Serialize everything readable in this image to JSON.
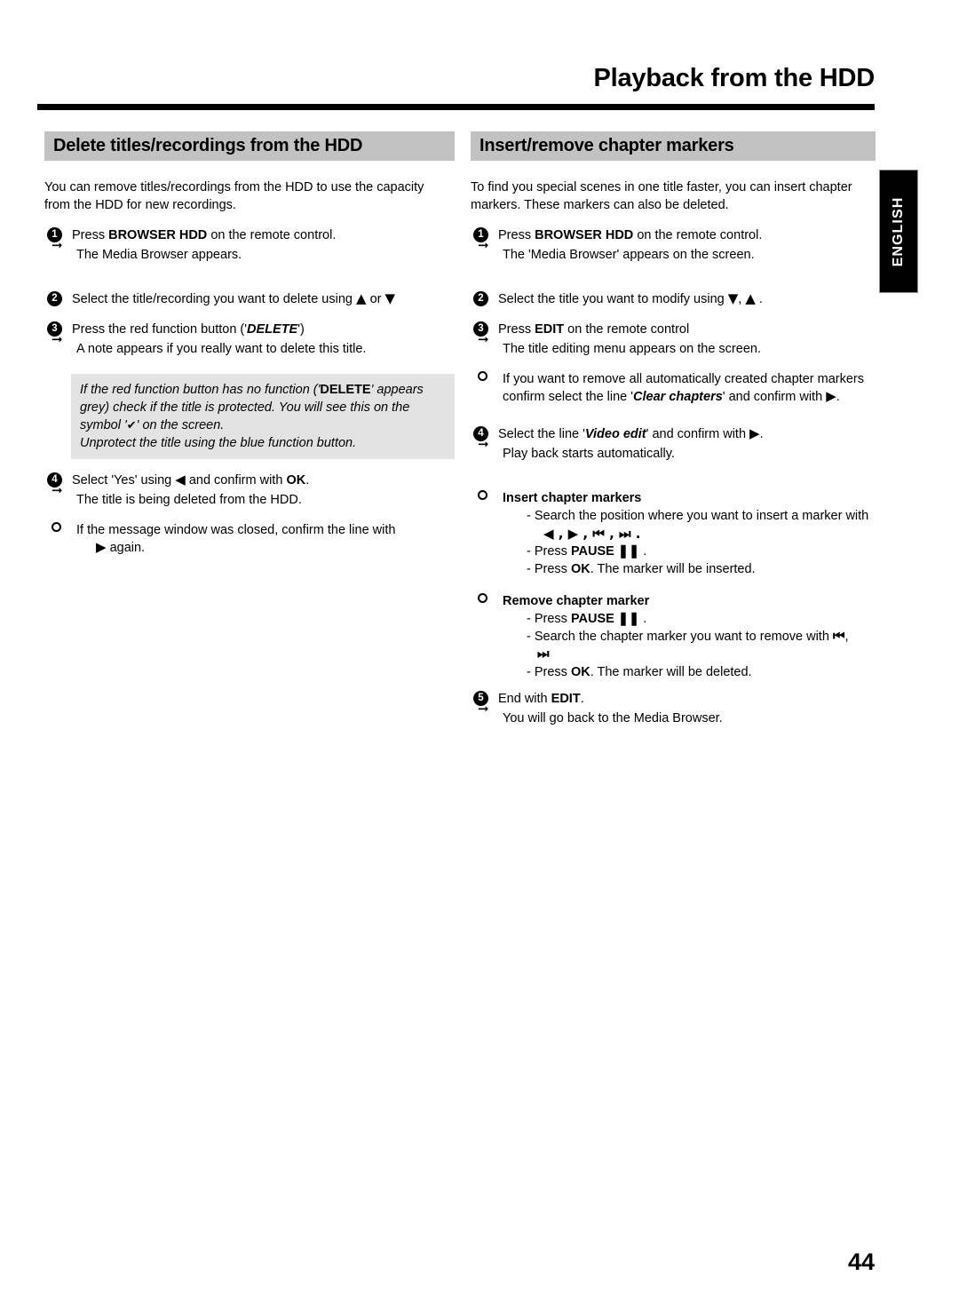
{
  "page": {
    "title": "Playback from the HDD",
    "number": "44",
    "language_tab": "ENGLISH"
  },
  "left": {
    "heading": "Delete titles/recordings from the HDD",
    "intro": "You can remove titles/recordings from the HDD to use the capacity from the HDD for new recordings.",
    "steps": [
      {
        "num": "1",
        "pre": "Press",
        "key": "BROWSER HDD",
        "post": "on the remote control.",
        "result": "The Media Browser appears."
      },
      {
        "num": "2",
        "pre": "Select the title/recording you want to delete using",
        "glyph1": "▲",
        "mid": "or",
        "glyph2": "▼",
        "post": ""
      },
      {
        "num": "3",
        "pre": "Press the red function button ('",
        "key": "DELETE",
        "post": "')",
        "result": "A note appears if you really want to delete this title."
      },
      {
        "num": "4",
        "pre": "Select 'Yes' using",
        "glyph1": "◀",
        "mid": "and confirm with",
        "key": "OK",
        "post": ".",
        "result": "The title is being deleted from the HDD."
      }
    ],
    "infobox": {
      "line1a": "If the red function button has no function ('",
      "line1b": "DELETE",
      "line1c": "' appears grey) check if the title is protected. You will see this on the symbol '",
      "line1d": "✔",
      "line1e": "' on the screen.",
      "line2": "Unprotect the title using the blue function button."
    },
    "note": {
      "text": "If the message window was closed, confirm the line with",
      "glyph": "▶",
      "after": "again."
    }
  },
  "right": {
    "heading": "Insert/remove chapter markers",
    "intro": "To find you special scenes in one title faster, you can insert chapter markers. These markers can also be deleted.",
    "steps": [
      {
        "num": "1",
        "pre": "Press",
        "key": "BROWSER HDD",
        "post": "on the remote control.",
        "result": "The 'Media Browser' appears on the screen."
      },
      {
        "num": "2",
        "pre": "Select the title you want to modify using",
        "glyph1": "▼",
        "sep": ",",
        "glyph2": "▲",
        "post": "."
      },
      {
        "num": "3",
        "pre": "Press",
        "key": "EDIT",
        "post": "on the remote control",
        "result": "The title editing menu appears on the screen."
      },
      {
        "num": "4",
        "pre": "Select the line '",
        "key": "Video edit",
        "post": "' and confirm with",
        "glyph1": "▶",
        "end": ".",
        "result": "Play back starts automatically."
      },
      {
        "num": "5",
        "pre": "End with",
        "key": "EDIT",
        "post": ".",
        "result": "You will go back to the Media Browser."
      }
    ],
    "clear_chapters_note": {
      "line1": "If you want to remove all automatically created chapter markers confirm select the line '",
      "emph": "Clear chapters",
      "line2": "' and confirm with",
      "glyph": "▶",
      "end": "."
    },
    "insert_markers": {
      "title": "Insert chapter markers",
      "item1": "- Search the position where you want to insert a marker with",
      "glyphs": "◀ , ▶ , ⏮ , ⏭ .",
      "item2_pre": "- Press",
      "item2_key": "PAUSE ❚❚",
      "item2_post": ".",
      "item3_pre": "- Press",
      "item3_key": "OK",
      "item3_post": ". The marker will be inserted."
    },
    "remove_markers": {
      "title": "Remove chapter marker",
      "item1_pre": "- Press",
      "item1_key": "PAUSE ❚❚",
      "item1_post": ".",
      "item2": "- Search the chapter marker you want to remove with",
      "glyph1": "⏮",
      "comma": ",",
      "glyph2": "⏭",
      "item3_pre": "- Press",
      "item3_key": "OK",
      "item3_post": ". The marker will be deleted."
    }
  }
}
